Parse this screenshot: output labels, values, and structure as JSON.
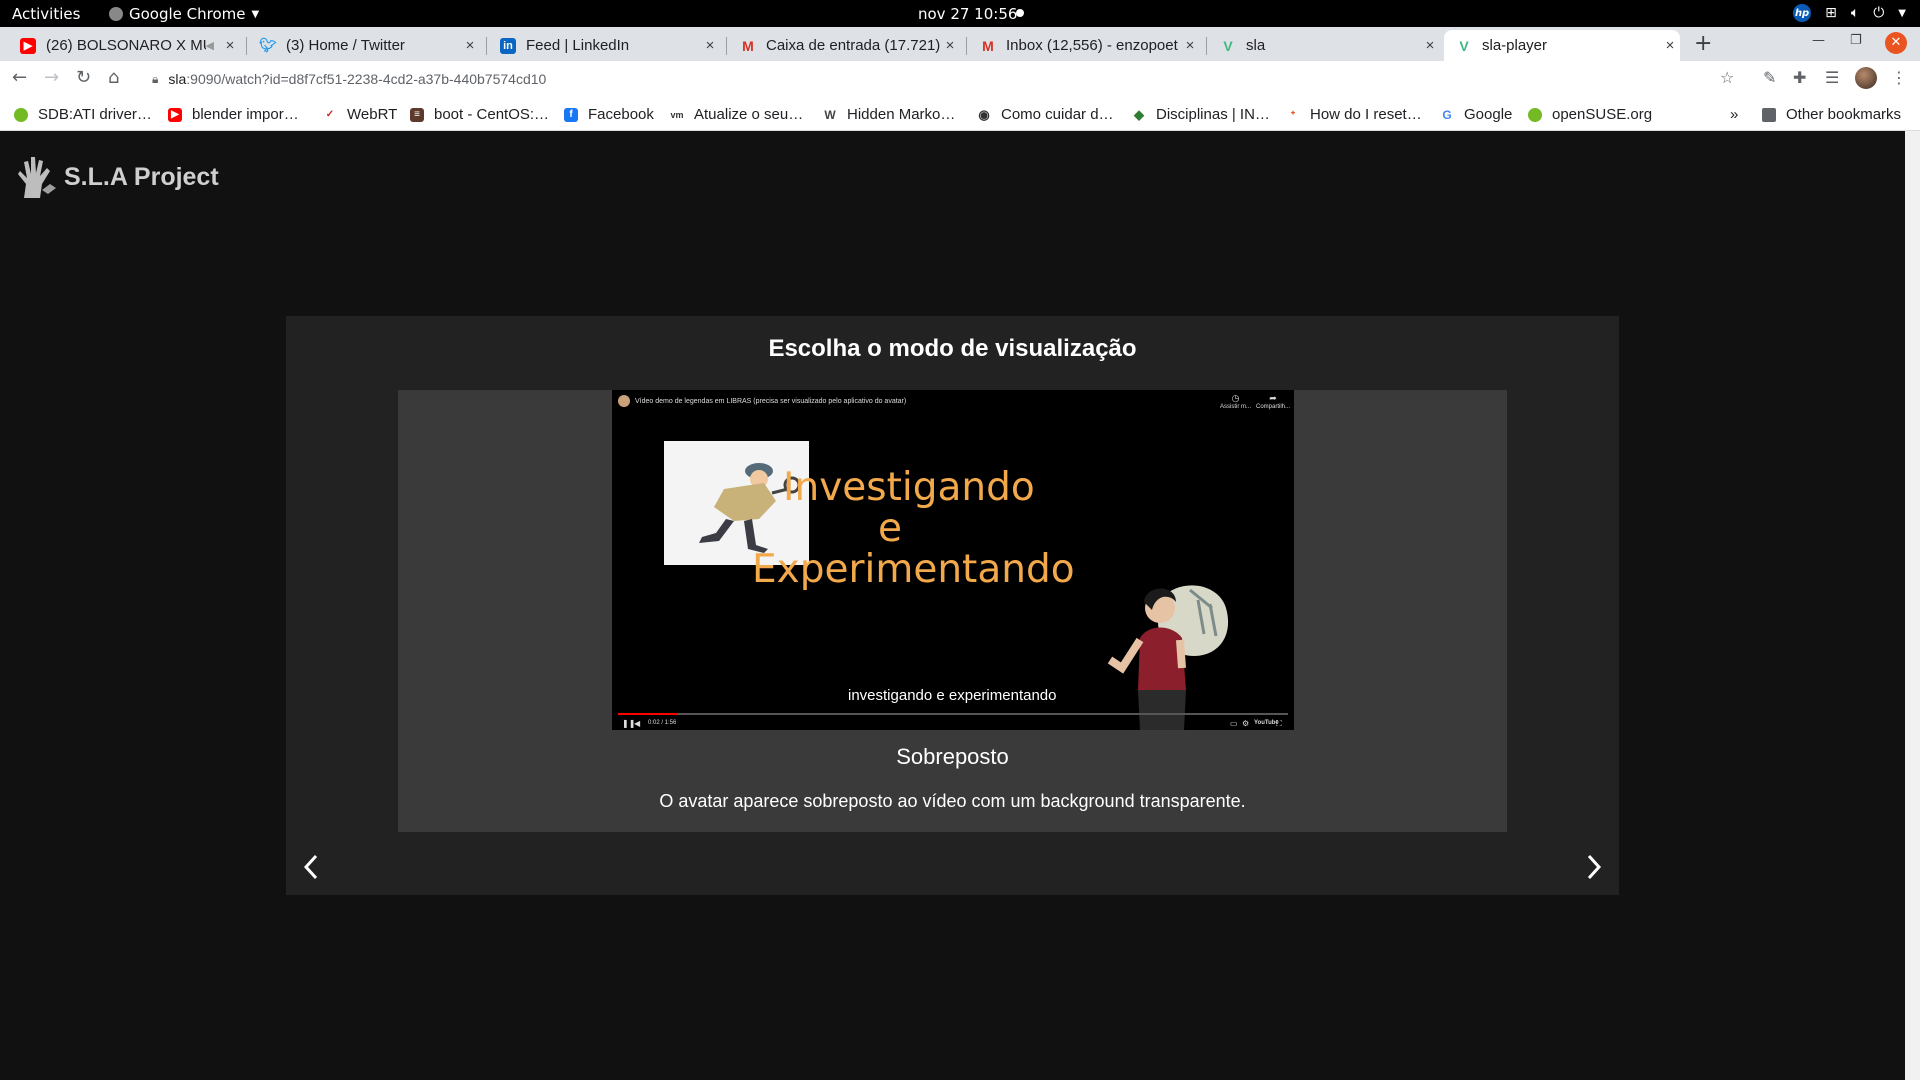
{
  "topbar": {
    "activities": "Activities",
    "app_name": "Google Chrome",
    "clock": "nov 27  10:56"
  },
  "tabs": [
    {
      "title": "(26) BOLSONARO X MU",
      "close": "×",
      "favicon": "youtube-icon",
      "color": "#ff0000"
    },
    {
      "title": "(3) Home / Twitter",
      "close": "×",
      "favicon": "twitter-icon",
      "color": "#1d9bf0"
    },
    {
      "title": "Feed | LinkedIn",
      "close": "×",
      "favicon": "linkedin-icon",
      "color": "#0a66c2"
    },
    {
      "title": "Caixa de entrada (17.721)",
      "close": "×",
      "favicon": "gmail-icon",
      "color": "#d93025"
    },
    {
      "title": "Inbox (12,556) - enzopoet",
      "close": "×",
      "favicon": "gmail-icon",
      "color": "#d93025"
    },
    {
      "title": "sla",
      "close": "×",
      "favicon": "vue-icon",
      "color": "#41b883"
    },
    {
      "title": "sla-player",
      "close": "×",
      "favicon": "vue-icon",
      "color": "#41b883"
    }
  ],
  "toolbar": {
    "url_host": "sla",
    "url_path": ":9090/watch?id=d8f7cf51-2238-4cd2-a37b-440b7574cd10"
  },
  "bookmarks": [
    {
      "label": "SDB:ATI driver…",
      "icon": "opensuse-icon",
      "color": "#73ba25"
    },
    {
      "label": "blender impor…",
      "icon": "youtube-icon",
      "color": "#ff0000"
    },
    {
      "label": "WebRT",
      "icon": "webrt-icon",
      "color": "#c62828"
    },
    {
      "label": "boot - CentOS:…",
      "icon": "stackexchange-icon",
      "color": "#5d3a2b"
    },
    {
      "label": "Facebook",
      "icon": "facebook-icon",
      "color": "#1877f2"
    },
    {
      "label": "Atualize o seu…",
      "icon": "vmware-icon",
      "color": "#333333"
    },
    {
      "label": "Hidden Marko…",
      "icon": "wikipedia-icon",
      "color": "#444444"
    },
    {
      "label": "Como cuidar d…",
      "icon": "globe-icon",
      "color": "#333333"
    },
    {
      "label": "Disciplinas | IN…",
      "icon": "diamond-icon",
      "color": "#2e7d32"
    },
    {
      "label": "How do I reset…",
      "icon": "askubuntu-icon",
      "color": "#e95420"
    },
    {
      "label": "Google",
      "icon": "google-icon",
      "color": "#4285f4"
    },
    {
      "label": "openSUSE.org",
      "icon": "opensuse-icon",
      "color": "#73ba25"
    }
  ],
  "bookmarks_more": "»",
  "other_bookmarks": "Other bookmarks",
  "page": {
    "logo_text": "S.L.A Project",
    "panel_title": "Escolha o modo de visualização",
    "video": {
      "yt_title": "Vídeo demo de legendas em LIBRAS (precisa ser visualizado pelo aplicativo do avatar)",
      "watch_later": "Assistir m...",
      "share": "Compartilh...",
      "title_lines": [
        "Investigando",
        "e",
        "Experimentando"
      ],
      "subtitle": "investigando e experimentando",
      "time": "0:02 / 1:56",
      "youtube": "YouTube",
      "progress": 0.09
    },
    "mode_name": "Sobreposto",
    "mode_description": "O avatar aparece sobreposto ao vídeo com um background transparente."
  }
}
